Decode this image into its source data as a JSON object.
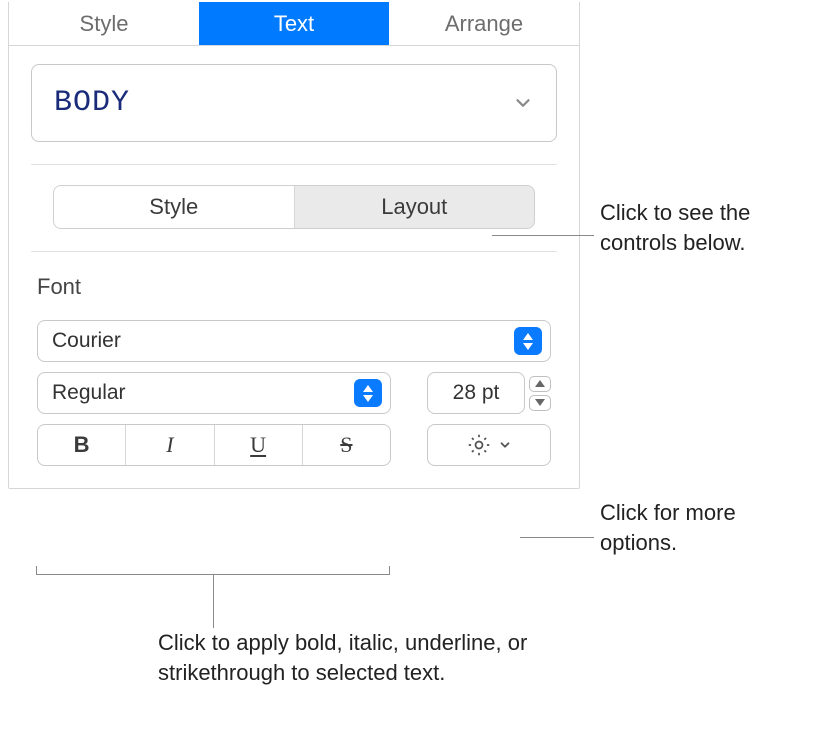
{
  "top_tabs": {
    "style": "Style",
    "text": "Text",
    "arrange": "Arrange"
  },
  "paragraph_style": {
    "selected": "BODY"
  },
  "sub_tabs": {
    "style": "Style",
    "layout": "Layout"
  },
  "font_section": {
    "label": "Font",
    "family": "Courier",
    "weight": "Regular",
    "size": "28 pt",
    "bold_glyph": "B",
    "italic_glyph": "I",
    "underline_glyph": "U",
    "strike_glyph": "S"
  },
  "callouts": {
    "sub_tabs": "Click to see the controls below.",
    "more": "Click for more options.",
    "styles": "Click to apply bold, italic, underline, or strikethrough to selected text."
  }
}
